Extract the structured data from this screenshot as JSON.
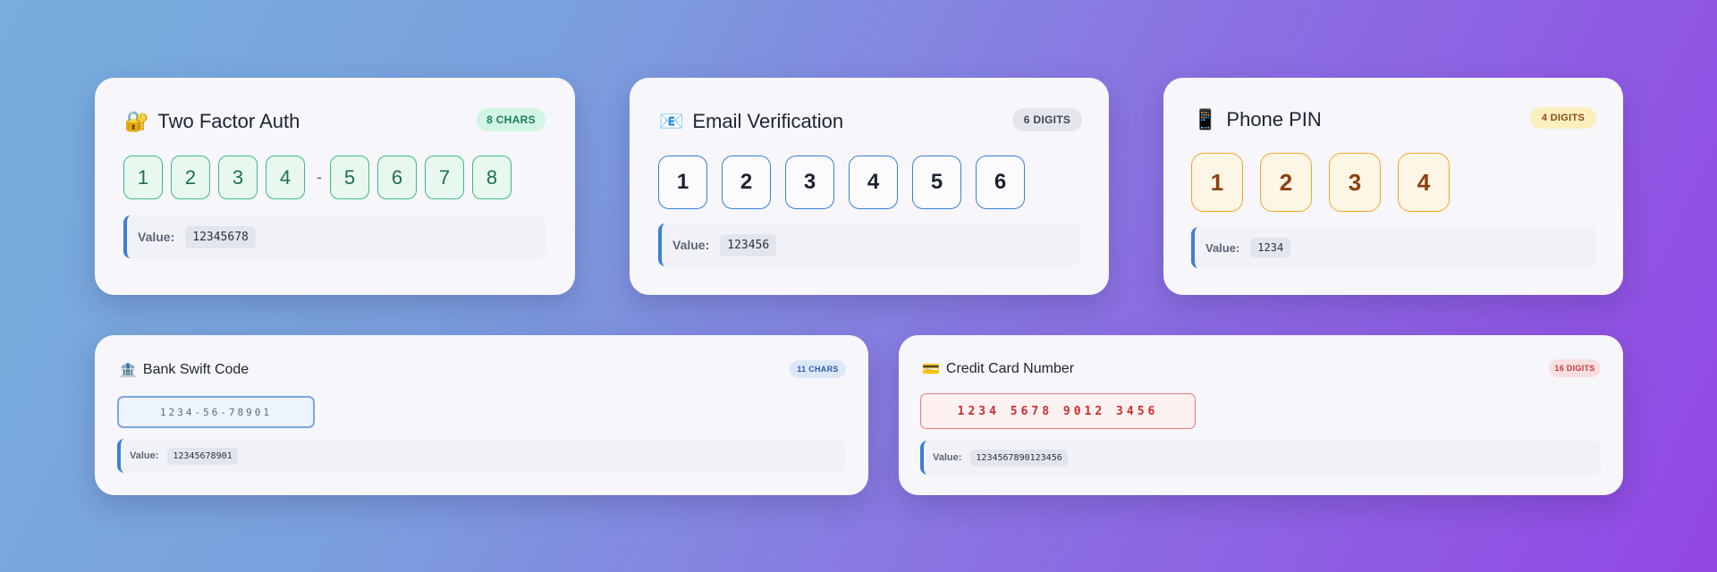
{
  "value_label": "Value:",
  "cards": {
    "two_factor": {
      "icon": "🔐",
      "icon_name": "lock-with-key-icon",
      "title": "Two Factor Auth",
      "badge": "8 CHARS",
      "digits_group1": [
        "1",
        "2",
        "3",
        "4"
      ],
      "separator": "-",
      "digits_group2": [
        "5",
        "6",
        "7",
        "8"
      ],
      "value": "12345678"
    },
    "email": {
      "icon": "📧",
      "icon_name": "email-envelope-icon",
      "title": "Email Verification",
      "badge": "6 DIGITS",
      "digits": [
        "1",
        "2",
        "3",
        "4",
        "5",
        "6"
      ],
      "value": "123456"
    },
    "phone": {
      "icon": "📱",
      "icon_name": "mobile-phone-icon",
      "title": "Phone PIN",
      "badge": "4 DIGITS",
      "digits": [
        "1",
        "2",
        "3",
        "4"
      ],
      "value": "1234"
    },
    "swift": {
      "icon": "🏦",
      "icon_name": "bank-icon",
      "title": "Bank Swift Code",
      "badge": "11 CHARS",
      "input_display": "1234-56-78901",
      "value": "12345678901"
    },
    "credit_card": {
      "icon": "💳",
      "icon_name": "credit-card-icon",
      "title": "Credit Card Number",
      "badge": "16 DIGITS",
      "input_display": "1234 5678 9012 3456",
      "value": "1234567890123456"
    }
  },
  "colors": {
    "background_start": "#77aedb",
    "background_end": "#9247e4",
    "two_factor_accent": "#3cba86",
    "email_accent": "#3c7fd8",
    "phone_accent": "#f0a92c",
    "swift_accent": "#7ea4e2",
    "credit_card_accent": "#ec7a7a",
    "value_border": "#3d7fd6"
  }
}
